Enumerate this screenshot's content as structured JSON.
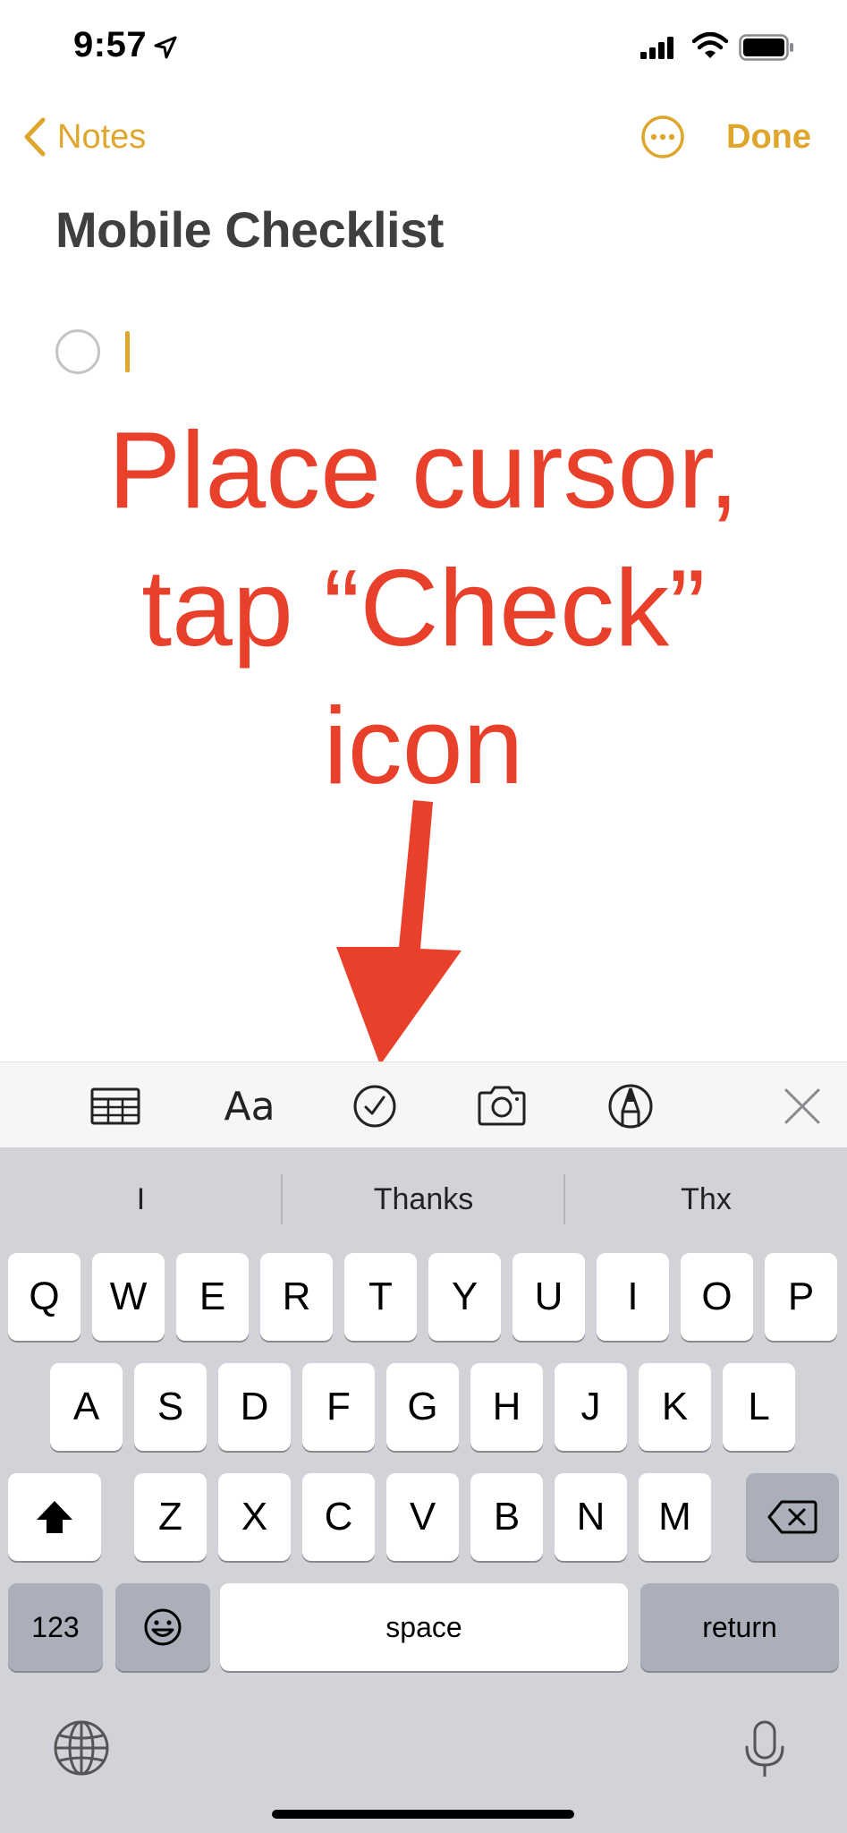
{
  "status_bar": {
    "time": "9:57",
    "icons": [
      "location-arrow-icon",
      "cellular-signal-icon",
      "wifi-icon",
      "battery-icon"
    ]
  },
  "nav": {
    "back_label": "Notes",
    "done_label": "Done",
    "accent_color": "#dfa62d"
  },
  "note": {
    "title": "Mobile Checklist"
  },
  "annotation": {
    "lines": [
      "Place cursor,",
      "tap “Check”",
      "icon"
    ],
    "color": "#e8402a"
  },
  "format_toolbar": {
    "items": [
      "table-icon",
      "Aa",
      "checklist-icon",
      "camera-icon",
      "markup-icon",
      "close-icon"
    ],
    "text_format_label": "Aa"
  },
  "keyboard": {
    "suggestions": [
      "I",
      "Thanks",
      "Thx"
    ],
    "row1": [
      "Q",
      "W",
      "E",
      "R",
      "T",
      "Y",
      "U",
      "I",
      "O",
      "P"
    ],
    "row2": [
      "A",
      "S",
      "D",
      "F",
      "G",
      "H",
      "J",
      "K",
      "L"
    ],
    "row3": [
      "Z",
      "X",
      "C",
      "V",
      "B",
      "N",
      "M"
    ],
    "numbers_label": "123",
    "space_label": "space",
    "return_label": "return"
  }
}
